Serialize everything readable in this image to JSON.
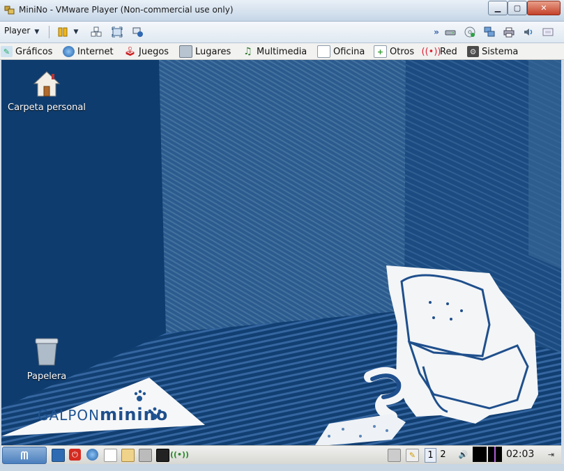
{
  "window": {
    "title": "MiniNo - VMware Player (Non-commercial use only)",
    "controls": [
      "minimize",
      "maximize",
      "close"
    ]
  },
  "toolbar": {
    "player_label": "Player",
    "icons": [
      "pause-icon",
      "send-ctrl-alt-del-icon",
      "fullscreen-icon",
      "unity-icon"
    ],
    "right_icons": [
      "more-icon",
      "hard-disk-icon",
      "cd-icon",
      "network-icon",
      "printer-icon",
      "sound-icon",
      "message-icon"
    ]
  },
  "guest_menu": {
    "items": [
      {
        "label": "Gráficos",
        "icon": "graphics-icon"
      },
      {
        "label": "Internet",
        "icon": "globe-icon"
      },
      {
        "label": "Juegos",
        "icon": "joystick-icon"
      },
      {
        "label": "Lugares",
        "icon": "places-icon"
      },
      {
        "label": "Multimedia",
        "icon": "music-icon"
      },
      {
        "label": "Oficina",
        "icon": "office-icon"
      },
      {
        "label": "Otros",
        "icon": "add-icon"
      },
      {
        "label": "Red",
        "icon": "wireless-icon"
      },
      {
        "label": "Sistema",
        "icon": "system-icon"
      }
    ]
  },
  "desktop": {
    "icons": [
      {
        "label": "Carpeta personal",
        "icon": "home-folder-icon"
      },
      {
        "label": "Papelera",
        "icon": "trash-icon"
      }
    ],
    "logo": {
      "prefix": "GALPON",
      "name": "minino"
    }
  },
  "panel": {
    "start_label": "",
    "workspaces": [
      "1",
      "2"
    ],
    "active_workspace": "1",
    "clock": "02:03"
  },
  "colors": {
    "desktop_bg": "#0e3c6e",
    "accent": "#1f4f8c"
  }
}
